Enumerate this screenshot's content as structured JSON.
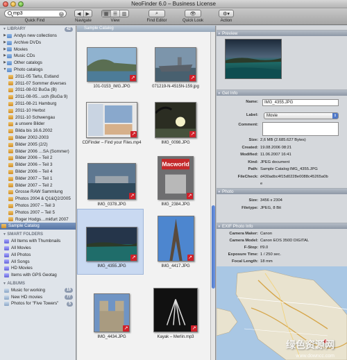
{
  "window": {
    "title": "NeoFinder 6.0 – Business License"
  },
  "toolbar": {
    "search_value": "mp3",
    "quick_find_label": "Quick Find",
    "navigate_label": "Navigate",
    "view_label": "View",
    "find_editor_label": "Find Editor",
    "quick_look_label": "Quick Look",
    "action_label": "Action"
  },
  "sidebar": {
    "library_header": "LIBRARY",
    "library_count": "42",
    "items": [
      {
        "label": "Andys new collections",
        "type": "folder",
        "indent": 1
      },
      {
        "label": "Archive DVDs",
        "type": "folder",
        "indent": 1
      },
      {
        "label": "Movies",
        "type": "folder",
        "indent": 1
      },
      {
        "label": "Music CDs",
        "type": "folder",
        "indent": 1
      },
      {
        "label": "Other catalogs",
        "type": "folder",
        "indent": 1
      },
      {
        "label": "Photo catalogs",
        "type": "folder",
        "indent": 1
      },
      {
        "label": "2011-05 Tartu, Estland",
        "type": "catalog",
        "indent": 2
      },
      {
        "label": "2011-07 Sommer diverses",
        "type": "catalog",
        "indent": 2
      },
      {
        "label": "2011-08-02 BuGa (B)",
        "type": "catalog",
        "indent": 2
      },
      {
        "label": "2011-08-05…uch (BuGa 9)",
        "type": "catalog",
        "indent": 2
      },
      {
        "label": "2011-08-21 Hamburg",
        "type": "catalog",
        "indent": 2
      },
      {
        "label": "2011-10 Herbst",
        "type": "catalog",
        "indent": 2
      },
      {
        "label": "2011-10 Schwengau",
        "type": "catalog",
        "indent": 2
      },
      {
        "label": "a unsere Bilder",
        "type": "catalog",
        "indent": 2
      },
      {
        "label": "Bilda bis 16.6.2002",
        "type": "catalog",
        "indent": 2
      },
      {
        "label": "Bilder 2002-2003",
        "type": "catalog",
        "indent": 2
      },
      {
        "label": "Bilder 2005 (2/2)",
        "type": "catalog",
        "indent": 2
      },
      {
        "label": "Bilder 2006 …SA (Sommer)",
        "type": "catalog",
        "indent": 2
      },
      {
        "label": "Bilder 2006 – Teil 2",
        "type": "catalog",
        "indent": 2
      },
      {
        "label": "Bilder 2006 – Teil 3",
        "type": "catalog",
        "indent": 2
      },
      {
        "label": "Bilder 2006 – Teil 4",
        "type": "catalog",
        "indent": 2
      },
      {
        "label": "Bilder 2007 – Teil 1",
        "type": "catalog",
        "indent": 2
      },
      {
        "label": "Bilder 2007 – Teil 2",
        "type": "catalog",
        "indent": 2
      },
      {
        "label": "Grosse RAW Sammlung",
        "type": "catalog",
        "indent": 2
      },
      {
        "label": "Photos 2004 & Q1&Q2/2005",
        "type": "catalog",
        "indent": 2
      },
      {
        "label": "Photos 2007 – Teil 3",
        "type": "catalog",
        "indent": 2
      },
      {
        "label": "Photos 2007 – Teil 5",
        "type": "catalog",
        "indent": 2
      },
      {
        "label": "Roger Hodgs…mkfurt 2007",
        "type": "catalog",
        "indent": 2
      },
      {
        "label": "Sample Catalog",
        "type": "catalog",
        "indent": 0,
        "selected": true
      }
    ],
    "smart_header": "SMART FOLDERS",
    "smart_items": [
      {
        "label": "All Items with Thumbnails"
      },
      {
        "label": "All Movies"
      },
      {
        "label": "All Photos"
      },
      {
        "label": "All Songs"
      },
      {
        "label": "HD Movies"
      },
      {
        "label": "Items with GPS Geotag"
      }
    ],
    "albums_header": "ALBUMS",
    "albums": [
      {
        "label": "Music for working",
        "count": "19"
      },
      {
        "label": "New HD movies",
        "count": "77"
      },
      {
        "label": "Photos for \"Five Towers\"",
        "count": "5"
      }
    ]
  },
  "center": {
    "path": "Sample Catalog",
    "items": [
      {
        "caption": "101-0153_IMG.JPG",
        "thumb": "coast"
      },
      {
        "caption": "071219-N-4515N-159.jpg",
        "thumb": "carrier"
      },
      {
        "caption": "CDFinder – Find your Files.mp4",
        "thumb": "screenshot"
      },
      {
        "caption": "IMG_0098.JPG",
        "thumb": "sunset"
      },
      {
        "caption": "IMG_0378.JPG",
        "thumb": "harbor"
      },
      {
        "caption": "IMG_2384.JPG",
        "thumb": "macworld"
      },
      {
        "caption": "IMG_4355.JPG",
        "thumb": "sea",
        "selected": true
      },
      {
        "caption": "IMG_4417.JPG",
        "thumb": "eiffel"
      },
      {
        "caption": "IMG_4434.JPG",
        "thumb": "notredame"
      },
      {
        "caption": "Kayak – Merlin.mp3",
        "thumb": "album"
      }
    ]
  },
  "right": {
    "preview_header": "Preview",
    "getinfo_header": "Get Info",
    "info": {
      "name_label": "Name:",
      "name_value": "IMG_4355.JPG",
      "label_label": "Label:",
      "label_value": "Movie",
      "comment_label": "Comment:",
      "comment_value": "",
      "size_label": "Size:",
      "size_value": "2,6 MB (2.685.627 Bytes)",
      "created_label": "Created:",
      "created_value": "19.08.2006 08:21",
      "modified_label": "Modified:",
      "modified_value": "11.06.2007 16:41",
      "kind_label": "Kind:",
      "kind_value": "JPEG document",
      "path_label": "Path:",
      "path_value": "Sample Catalog:IMG_4355.JPG",
      "filecheck_label": "FileCheck:",
      "filecheck_value1": "d430adbc4f15d0228e0088c45265a0b",
      "filecheck_value2": "e"
    },
    "photo_header": "Photo",
    "photo": {
      "size_label": "Size:",
      "size_value": "3456 x 2304",
      "filetype_label": "Filetype:",
      "filetype_value": "JPEG, 8 Bit"
    },
    "exif_header": "EXIF Photo Info",
    "exif": {
      "maker_label": "Camera Maker:",
      "maker_value": "Canon",
      "model_label": "Camera Model:",
      "model_value": "Canon EOS 350D DIGITAL",
      "fstop_label": "F-Stop:",
      "fstop_value": "f/9.0",
      "exposure_label": "Exposure Time:",
      "exposure_value": "1 / 250 sec.",
      "focal_label": "Focal Length:",
      "focal_value": "18 mm"
    },
    "watermark": "绿色资源网",
    "watermark_url": "www.downcc.com"
  }
}
